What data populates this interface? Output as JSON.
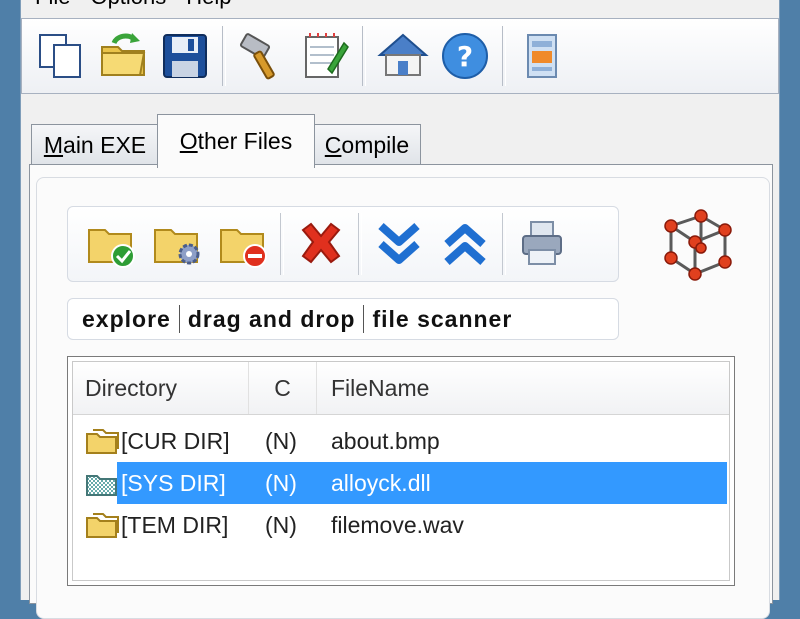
{
  "menu": [
    "File",
    "Options",
    "Help"
  ],
  "toolbar": {
    "buttons": [
      "new-icon",
      "open-folder-icon",
      "save-icon",
      "hammer-icon",
      "notepad-icon",
      "home-icon",
      "help-icon",
      "archive-icon"
    ]
  },
  "tabs": [
    {
      "label": "Main EXE",
      "mnemonic": "M",
      "rest": "ain EXE"
    },
    {
      "label": "Other Files",
      "mnemonic": "O",
      "rest": "ther Files"
    },
    {
      "label": "Compile",
      "mnemonic": "C",
      "rest": "ompile"
    }
  ],
  "filetools": {
    "buttons": [
      "folder-check-icon",
      "folder-gear-icon",
      "folder-remove-icon",
      "delete-icon",
      "move-down-icon",
      "move-up-icon",
      "print-icon"
    ]
  },
  "links": [
    "explore",
    "drag and drop",
    "file scanner"
  ],
  "list": {
    "columns": [
      "Directory",
      "C",
      "FileName"
    ],
    "rows": [
      {
        "dir": "[CUR DIR]",
        "c": "(N)",
        "file": "about.bmp",
        "icon": "folder-icon",
        "selected": false
      },
      {
        "dir": "[SYS DIR]",
        "c": "(N)",
        "file": "alloyck.dll",
        "icon": "system-dir-icon",
        "selected": true
      },
      {
        "dir": "[TEM DIR]",
        "c": "(N)",
        "file": "filemove.wav",
        "icon": "folder-icon",
        "selected": false
      }
    ]
  },
  "colors": {
    "selection": "#3399ff",
    "accent_red": "#e0301e",
    "accent_blue": "#1f6fd1"
  }
}
